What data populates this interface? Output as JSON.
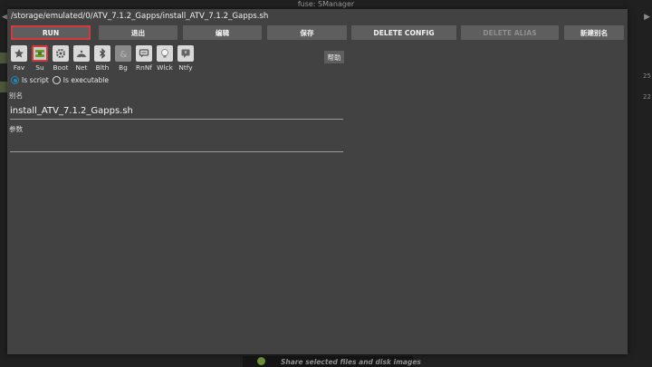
{
  "background": {
    "window_title": "fuse: SManager",
    "side_numbers": [
      "25",
      "22"
    ],
    "bottom_hint": "Share selected files and disk images"
  },
  "dialog": {
    "path": "/storage/emulated/0/ATV_7.1.2_Gapps/install_ATV_7.1.2_Gapps.sh",
    "buttons": {
      "run": "RUN",
      "exit": "退出",
      "edit": "编辑",
      "save": "保存",
      "delete_config": "DELETE CONFIG",
      "delete_alias": "DELETE ALIAS",
      "new_alias": "新建别名"
    },
    "flags": [
      {
        "label": "Fav",
        "icon": "star-icon"
      },
      {
        "label": "Su",
        "icon": "root-icon",
        "selected": true
      },
      {
        "label": "Boot",
        "icon": "gear-icon"
      },
      {
        "label": "Net",
        "icon": "network-icon"
      },
      {
        "label": "Blth",
        "icon": "bluetooth-icon"
      },
      {
        "label": "Bg",
        "icon": "background-icon",
        "dimmed": true
      },
      {
        "label": "RnNf",
        "icon": "notification-icon"
      },
      {
        "label": "Wlck",
        "icon": "wakelock-icon"
      },
      {
        "label": "Ntfy",
        "icon": "notify-icon"
      }
    ],
    "help": "帮助",
    "mode": {
      "script_label": "Is script",
      "executable_label": "Is executable",
      "selected": "script"
    },
    "alias_label": "别名",
    "alias_value": "install_ATV_7.1.2_Gapps.sh",
    "args_label": "参数",
    "args_value": "",
    "accent_color": "#1e88b8",
    "focus_color": "#d23b3b"
  }
}
